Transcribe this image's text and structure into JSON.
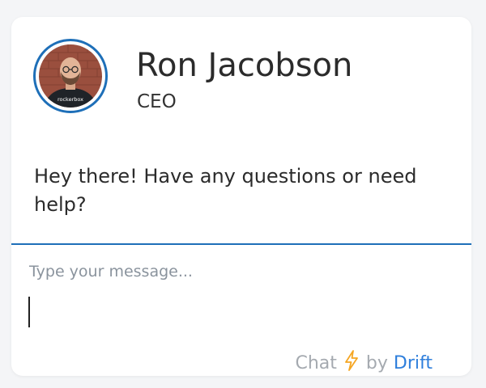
{
  "agent": {
    "name": "Ron Jacobson",
    "role": "CEO",
    "avatar_shirt_text": "rockerbox"
  },
  "conversation": {
    "message": "Hey there! Have any questions or need help?"
  },
  "composer": {
    "placeholder": "Type your message..."
  },
  "branding": {
    "prefix": "Chat",
    "icon": "lightning-bolt-icon",
    "by": "by",
    "brand": "Drift"
  },
  "colors": {
    "accent": "#1e6fb8",
    "brand_link": "#2f7fdc",
    "bolt": "#f5a623"
  }
}
